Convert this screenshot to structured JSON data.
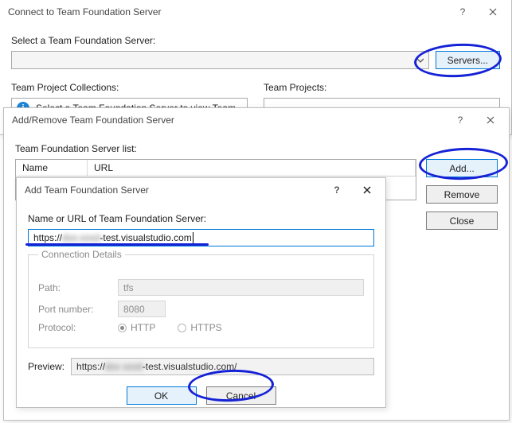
{
  "connect": {
    "title": "Connect to Team Foundation Server",
    "select_label": "Select a Team Foundation Server:",
    "servers_btn": "Servers...",
    "collections_label": "Team Project Collections:",
    "projects_label": "Team Projects:",
    "info_text": "Select a Team Foundation Server to view Team"
  },
  "addremove": {
    "title": "Add/Remove Team Foundation Server",
    "list_label": "Team Foundation Server list:",
    "col_name": "Name",
    "col_url": "URL",
    "add_btn": "Add...",
    "remove_btn": "Remove",
    "close_btn": "Close"
  },
  "addtfs": {
    "title": "Add Team Foundation Server",
    "name_label": "Name or URL of Team Foundation Server:",
    "url_prefix": "https://",
    "url_blur": "dxx-xxxd",
    "url_suffix": "-test.visualstudio.com",
    "details_legend": "Connection Details",
    "path_label": "Path:",
    "path_value": "tfs",
    "port_label": "Port number:",
    "port_value": "8080",
    "protocol_label": "Protocol:",
    "http_label": "HTTP",
    "https_label": "HTTPS",
    "preview_label": "Preview:",
    "preview_prefix": "https://",
    "preview_blur": "dxx xxxd",
    "preview_suffix": "-test.visualstudio.com/",
    "ok_btn": "OK",
    "cancel_btn": "Cancel"
  }
}
